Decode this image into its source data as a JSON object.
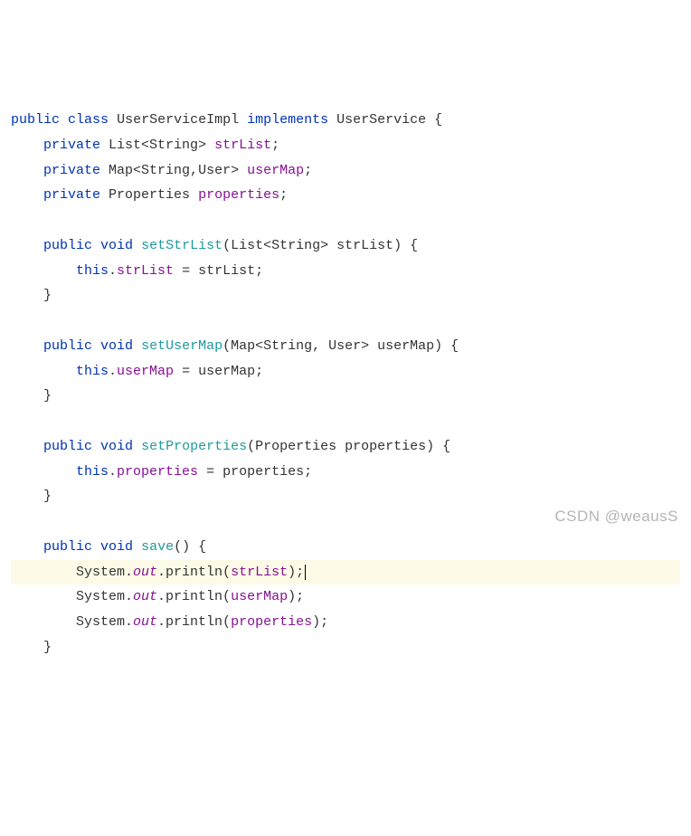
{
  "code": {
    "l1": {
      "kw1": "public",
      "kw2": "class",
      "cls": "UserServiceImpl",
      "kw3": "implements",
      "iface": "UserService",
      "brace": " {"
    },
    "l2": {
      "kw": "private",
      "type": "List<String>",
      "fld": "strList",
      "end": ";"
    },
    "l3": {
      "kw": "private",
      "type": "Map<String,User>",
      "fld": "userMap",
      "end": ";"
    },
    "l4": {
      "kw": "private",
      "type": "Properties",
      "fld": "properties",
      "end": ";"
    },
    "m1": {
      "sig1": "public",
      "sig2": "void",
      "name": "setStrList",
      "params": "(List<String> strList) {",
      "body_kw": "this",
      "body_dot": ".",
      "body_fld": "strList",
      "body_eq": " = strList;",
      "close": "}"
    },
    "m2": {
      "sig1": "public",
      "sig2": "void",
      "name": "setUserMap",
      "params": "(Map<String, User> userMap) {",
      "body_kw": "this",
      "body_dot": ".",
      "body_fld": "userMap",
      "body_eq": " = userMap;",
      "close": "}"
    },
    "m3": {
      "sig1": "public",
      "sig2": "void",
      "name": "setProperties",
      "params": "(Properties properties) {",
      "body_kw": "this",
      "body_dot": ".",
      "body_fld": "properties",
      "body_eq": " = properties;",
      "close": "}"
    },
    "m4": {
      "sig1": "public",
      "sig2": "void",
      "name": "save",
      "params": "() {",
      "p_sys": "System.",
      "p_out": "out",
      "p_call": ".println(",
      "arg1": "strList",
      "arg2": "userMap",
      "arg3": "properties",
      "p_end": ");",
      "close": "}"
    }
  },
  "watermark": "CSDN @weausS"
}
